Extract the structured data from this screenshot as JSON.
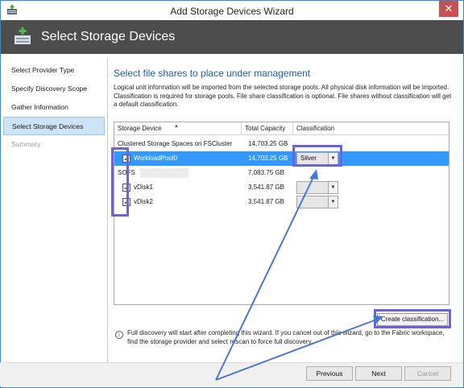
{
  "window": {
    "title": "Add Storage Devices Wizard",
    "close_glyph": "✕"
  },
  "banner": {
    "title": "Select Storage Devices"
  },
  "nav": {
    "items": [
      {
        "label": "Select Provider Type",
        "state": "normal"
      },
      {
        "label": "Specify Discovery Scope",
        "state": "normal"
      },
      {
        "label": "Gather Information",
        "state": "normal"
      },
      {
        "label": "Select Storage Devices",
        "state": "active"
      },
      {
        "label": "Summary",
        "state": "disabled"
      }
    ]
  },
  "main": {
    "section_title": "Select file shares to place under management",
    "info": "Logical unit information will be imported from the selected storage pools. All physical disk information will be imported. Classification is required for storage pools. File share classification is optional. File shares without classification will get a default classification.",
    "grid": {
      "columns": [
        "Storage Device",
        "Total Capacity",
        "Classification"
      ],
      "rows": [
        {
          "name": "Clustered Storage Spaces on FSCluster",
          "capacity": "14,703.25 GB",
          "classification": "",
          "checkbox": false,
          "selected": false,
          "combo": false
        },
        {
          "name": "WorkloadPool0",
          "capacity": "14,703.25 GB",
          "classification": "Silver",
          "checkbox": true,
          "checked": true,
          "selected": true,
          "combo": true
        },
        {
          "name": "SOFS",
          "capacity": "7,083.75 GB",
          "classification": "",
          "checkbox": false,
          "selected": false,
          "combo": false
        },
        {
          "name": "vDisk1",
          "capacity": "3,541.87 GB",
          "classification": "",
          "checkbox": true,
          "checked": true,
          "selected": false,
          "combo": true
        },
        {
          "name": "vDisk2",
          "capacity": "3,541.87 GB",
          "classification": "",
          "checkbox": true,
          "checked": true,
          "selected": false,
          "combo": true
        }
      ]
    },
    "create_button": "Create classification...",
    "note_icon": "i",
    "note": "Full discovery will start after completing this wizard. If you cancel out of this wizard, go to the Fabric workspace, find the storage provider and select rescan to force full discovery."
  },
  "footer": {
    "previous": "Previous",
    "next": "Next",
    "cancel": "Cancel"
  },
  "icons": {
    "app": "storage-app-icon",
    "banner": "add-storage-icon",
    "dropdown": "chevron-down-icon"
  },
  "colors": {
    "selection": "#3399ff",
    "highlight": "#6b63d6",
    "arrow": "#4a78c8",
    "banner": "#4d4d4d",
    "link_title": "#1f5da8"
  }
}
